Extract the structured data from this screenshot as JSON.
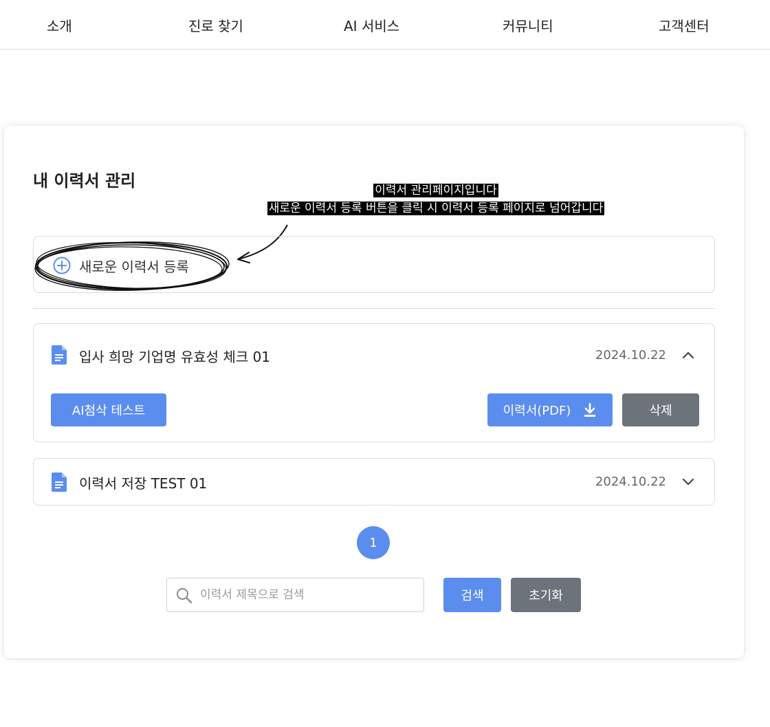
{
  "nav": {
    "items": [
      {
        "label": "소개"
      },
      {
        "label": "진로 찾기"
      },
      {
        "label": "AI 서비스"
      },
      {
        "label": "커뮤니티"
      },
      {
        "label": "고객센터"
      }
    ]
  },
  "page": {
    "title": "내 이력서 관리",
    "annotation": {
      "line1": "이력서 관리페이지입니다",
      "line2": "새로운 이력서 등록 버튼을 클릭 시 이력서 등록 페이지로 넘어갑니다"
    },
    "new_resume_label": "새로운 이력서 등록"
  },
  "resumes": [
    {
      "title": "입사 희망 기업명 유효성 체크 01",
      "date": "2024.10.22",
      "expanded": true,
      "actions": {
        "ai_test": "AI첨삭 테스트",
        "pdf": "이력서(PDF)",
        "delete": "삭제"
      }
    },
    {
      "title": "이력서 저장 TEST 01",
      "date": "2024.10.22",
      "expanded": false
    }
  ],
  "pagination": {
    "current": "1"
  },
  "search": {
    "placeholder": "이력서 제목으로 검색",
    "value": "",
    "search_label": "검색",
    "reset_label": "초기화"
  },
  "colors": {
    "primary": "#5b8def",
    "secondary": "#6d737b",
    "border": "#dcdcdc"
  },
  "icons": {
    "new": "plus-circle-icon",
    "document": "document-icon",
    "download": "download-icon",
    "expanded": "chevron-up-icon",
    "collapsed": "chevron-down-icon",
    "search": "search-icon"
  }
}
